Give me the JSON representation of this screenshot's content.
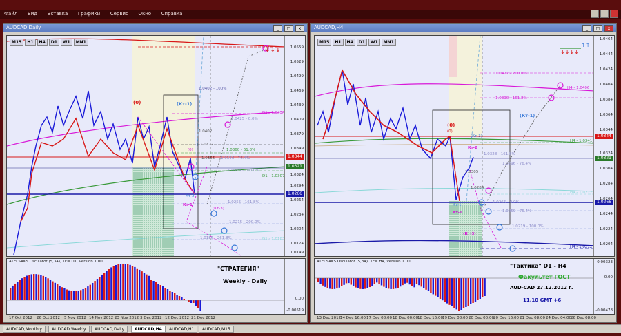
{
  "menu": [
    "Файл",
    "Вид",
    "Вставка",
    "Графики",
    "Сервис",
    "Окно",
    "Справка"
  ],
  "timeframes": [
    "M15",
    "H1",
    "H4",
    "D1",
    "W1",
    "MN1"
  ],
  "left": {
    "title": "AUDCAD,Daily",
    "y_ticks": [
      "1.0559",
      "1.0529",
      "1.0499",
      "1.0469",
      "1.0439",
      "1.0409",
      "1.0379",
      "1.0349",
      "1.0324",
      "1.0294",
      "1.0264",
      "1.0234",
      "1.0204",
      "1.0174",
      "1.0149"
    ],
    "x_ticks": [
      "17 Oct 2012",
      "26 Oct 2012",
      "5 Nov 2012",
      "14 Nov 2012",
      "23 Nov 2012",
      "3 Dec 2012",
      "12 Dec 2012",
      "21 Dec 2012"
    ],
    "price_badge": "1.0344",
    "price_badge2": "1.0321",
    "price_badge3": "1.0266",
    "osc_label": "ATEI.SAKS.Oscillator (5,34), TF= D1, version 1.00",
    "osc_ticks": [
      "0.00",
      "-0.00519"
    ],
    "text1": "\"СТРАТЕГИЯ\"",
    "text2": "Weekly - Daily",
    "labels": {
      "l0": "(0)",
      "l0b": "(0)",
      "kt1": "(Кт-1)",
      "kt2": "Кт-2",
      "kt1b": "Кт-1",
      "kt3": "(Кт-3)",
      "fib1": "1.0402 - 100%",
      "fib2": "1.0425 - 0.0%",
      "fib3": "1.0360 - 61.8%",
      "fib4": "1.0346 - 76.4%",
      "fib5": "1.0328 - 100.0%",
      "fib6": "1.0255 - 161.8%",
      "fib7": "1.0215 - 200.0%",
      "fib8": "1.0186 - 261.8%",
      "d1a": "D1 - 1.0434",
      "d1b": "D1 - 1.0307",
      "d1c": "D1 - 1.0183",
      "v1": "1.0402",
      "v2": "1.0372",
      "v3": "1.0355",
      "v4": "1.0348",
      "v5": "1.0330"
    }
  },
  "right": {
    "title": "AUDCAD,H4",
    "y_ticks": [
      "1.0464",
      "1.0444",
      "1.0424",
      "1.0404",
      "1.0384",
      "1.0364",
      "1.0344",
      "1.0324",
      "1.0304",
      "1.0284",
      "1.0264",
      "1.0244",
      "1.0224",
      "1.0204"
    ],
    "x_ticks": [
      "13 Dec 2012",
      "14 Dec 16:00",
      "17 Dec 08:00",
      "18 Dec 00:00",
      "18 Dec 16:00",
      "19 Dec 08:00",
      "20 Dec 00:00",
      "20 Dec 16:00",
      "21 Dec 08:00",
      "24 Dec 04:00",
      "26 Dec 08:00"
    ],
    "price_badge": "1.0344",
    "price_badge2": "1.0321",
    "price_badge3": "1.0266",
    "osc_label": "ATEI.SAKS.Oscillator (5,34), TF= H4, version 1.00",
    "osc_ticks": [
      "0.00323",
      "0.00",
      "-0.00478"
    ],
    "text1": "\"Тактика\"  D1 - H4",
    "text2": "Факультет ГОСТ",
    "text3": "AUD-CAD  27.12.2012  г.",
    "text4": "11.10   GMT +6",
    "labels": {
      "l0": "(0)",
      "l0b": "(0)",
      "kt1": "(Кт-1)",
      "kt2": "Кт-2",
      "kt1b": "Кт-1",
      "kt1c": "Кт-1",
      "kt3": "(Кт-3)",
      "kt3b": "(Кт-3)",
      "f1": "1.0427 - 200.0%",
      "f2": "1.0390 - 161.8%",
      "f3": "H4 - 1.0406",
      "f4": "H4 - 1.0341",
      "f5": "1.0328 - 161.8%",
      "f6": "1.0296 - 76.4%",
      "f7": "1.0266 - 0.0%",
      "f8": "1.0259 - 76.4%",
      "f9": "1.0219 - 100.0%",
      "f10": "H4 - 1.0212",
      "f11": "H4 - 1.0277",
      "v1": "1.0305",
      "v2": "1.0284",
      "v3": "1.0314",
      "v4": "1.0328"
    }
  },
  "tabs": [
    "AUDCAD,Monthly",
    "AUDCAD,Weekly",
    "AUDCAD,Daily",
    "AUDCAD,H4",
    "AUDCAD,H1",
    "AUDCAD,M15"
  ],
  "active_tab": "AUDCAD,H4"
}
